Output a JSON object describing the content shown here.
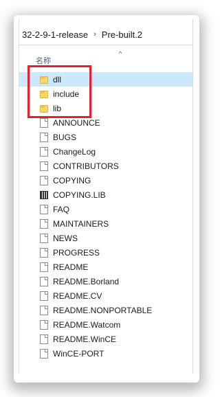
{
  "breadcrumb": {
    "parent": "32-2-9-1-release",
    "separator": "›",
    "current": "Pre-built.2"
  },
  "column_header": {
    "name_label": "名称",
    "sort_glyph": "^"
  },
  "files": [
    {
      "name": "dll",
      "type": "folder",
      "icon": "folder-icon",
      "selected": true
    },
    {
      "name": "include",
      "type": "folder",
      "icon": "folder-icon",
      "selected": false
    },
    {
      "name": "lib",
      "type": "folder",
      "icon": "folder-icon",
      "selected": false
    },
    {
      "name": "ANNOUNCE",
      "type": "file",
      "icon": "file-icon",
      "selected": false
    },
    {
      "name": "BUGS",
      "type": "file",
      "icon": "file-icon",
      "selected": false
    },
    {
      "name": "ChangeLog",
      "type": "file",
      "icon": "file-icon",
      "selected": false
    },
    {
      "name": "CONTRIBUTORS",
      "type": "file",
      "icon": "file-icon",
      "selected": false
    },
    {
      "name": "COPYING",
      "type": "file",
      "icon": "file-icon",
      "selected": false
    },
    {
      "name": "COPYING.LIB",
      "type": "lib",
      "icon": "library-file-icon",
      "selected": false
    },
    {
      "name": "FAQ",
      "type": "file",
      "icon": "file-icon",
      "selected": false
    },
    {
      "name": "MAINTAINERS",
      "type": "file",
      "icon": "file-icon",
      "selected": false
    },
    {
      "name": "NEWS",
      "type": "file",
      "icon": "file-icon",
      "selected": false
    },
    {
      "name": "PROGRESS",
      "type": "file",
      "icon": "file-icon",
      "selected": false
    },
    {
      "name": "README",
      "type": "file",
      "icon": "file-icon",
      "selected": false
    },
    {
      "name": "README.Borland",
      "type": "file",
      "icon": "file-icon",
      "selected": false
    },
    {
      "name": "README.CV",
      "type": "file",
      "icon": "file-icon",
      "selected": false
    },
    {
      "name": "README.NONPORTABLE",
      "type": "file",
      "icon": "file-icon",
      "selected": false
    },
    {
      "name": "README.Watcom",
      "type": "file",
      "icon": "file-icon",
      "selected": false
    },
    {
      "name": "README.WinCE",
      "type": "file",
      "icon": "file-icon",
      "selected": false
    },
    {
      "name": "WinCE-PORT",
      "type": "file",
      "icon": "file-icon",
      "selected": false
    }
  ],
  "colors": {
    "selection": "#cce8ff",
    "highlight_box": "#e5202e",
    "folder": "#ffd766"
  }
}
